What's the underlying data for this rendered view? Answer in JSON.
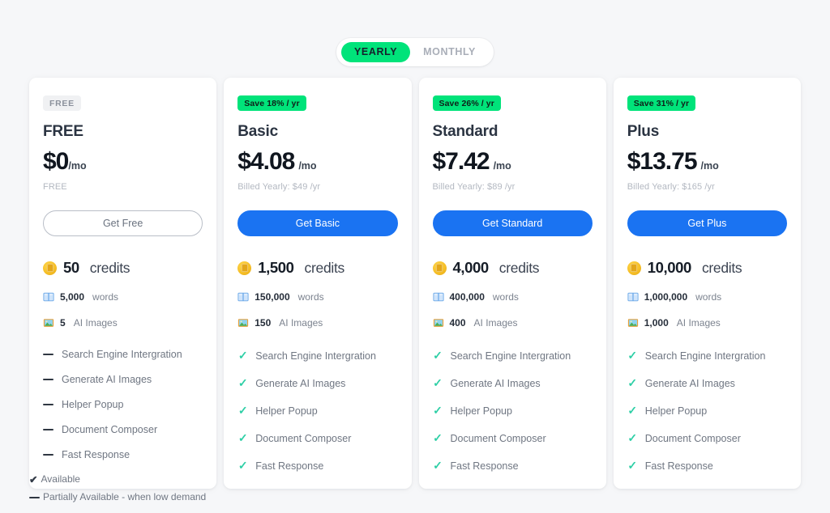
{
  "billing_toggle": {
    "options": [
      {
        "label": "YEARLY",
        "active": true
      },
      {
        "label": "MONTHLY",
        "active": false
      }
    ]
  },
  "colors": {
    "accent_green": "#00e37a",
    "accent_blue": "#1a73f2",
    "check_teal": "#2ecfa6",
    "page_background": "#f6f7f9",
    "card_background": "#ffffff"
  },
  "plans": [
    {
      "badge": "FREE",
      "badge_style": "free",
      "name": "FREE",
      "price": "$0",
      "per": "/mo",
      "billed": "FREE",
      "cta": "Get Free",
      "cta_style": "outline",
      "credits_amount": "50",
      "credits_label": "credits",
      "words_amount": "5,000",
      "words_label": "words",
      "images_amount": "5",
      "images_label": "AI Images",
      "features": [
        {
          "label": "Search Engine Intergration",
          "state": "dash"
        },
        {
          "label": "Generate AI Images",
          "state": "dash"
        },
        {
          "label": "Helper Popup",
          "state": "dash"
        },
        {
          "label": "Document Composer",
          "state": "dash"
        },
        {
          "label": "Fast Response",
          "state": "dash"
        }
      ]
    },
    {
      "badge": "Save 18% / yr",
      "badge_style": "save",
      "name": "Basic",
      "price": "$4.08",
      "per": "/mo",
      "billed": "Billed Yearly: $49 /yr",
      "cta": "Get Basic",
      "cta_style": "solid",
      "credits_amount": "1,500",
      "credits_label": "credits",
      "words_amount": "150,000",
      "words_label": "words",
      "images_amount": "150",
      "images_label": "AI Images",
      "features": [
        {
          "label": "Search Engine Intergration",
          "state": "check"
        },
        {
          "label": "Generate AI Images",
          "state": "check"
        },
        {
          "label": "Helper Popup",
          "state": "check"
        },
        {
          "label": "Document Composer",
          "state": "check"
        },
        {
          "label": "Fast Response",
          "state": "check"
        }
      ]
    },
    {
      "badge": "Save 26% / yr",
      "badge_style": "save",
      "name": "Standard",
      "price": "$7.42",
      "per": "/mo",
      "billed": "Billed Yearly: $89 /yr",
      "cta": "Get Standard",
      "cta_style": "solid",
      "credits_amount": "4,000",
      "credits_label": "credits",
      "words_amount": "400,000",
      "words_label": "words",
      "images_amount": "400",
      "images_label": "AI Images",
      "features": [
        {
          "label": "Search Engine Intergration",
          "state": "check"
        },
        {
          "label": "Generate AI Images",
          "state": "check"
        },
        {
          "label": "Helper Popup",
          "state": "check"
        },
        {
          "label": "Document Composer",
          "state": "check"
        },
        {
          "label": "Fast Response",
          "state": "check"
        }
      ]
    },
    {
      "badge": "Save 31% / yr",
      "badge_style": "save",
      "name": "Plus",
      "price": "$13.75",
      "per": "/mo",
      "billed": "Billed Yearly: $165 /yr",
      "cta": "Get Plus",
      "cta_style": "solid",
      "credits_amount": "10,000",
      "credits_label": "credits",
      "words_amount": "1,000,000",
      "words_label": "words",
      "images_amount": "1,000",
      "images_label": "AI Images",
      "features": [
        {
          "label": "Search Engine Intergration",
          "state": "check"
        },
        {
          "label": "Generate AI Images",
          "state": "check"
        },
        {
          "label": "Helper Popup",
          "state": "check"
        },
        {
          "label": "Document Composer",
          "state": "check"
        },
        {
          "label": "Fast Response",
          "state": "check"
        }
      ]
    }
  ],
  "legend": {
    "available_mark": "✔",
    "available_label": "Available",
    "partial_label": "Partially Available - when low demand"
  },
  "icons": {
    "coin": "coin-icon",
    "book": "book-icon",
    "picture": "picture-icon",
    "check": "check-icon",
    "dash": "dash-icon"
  }
}
